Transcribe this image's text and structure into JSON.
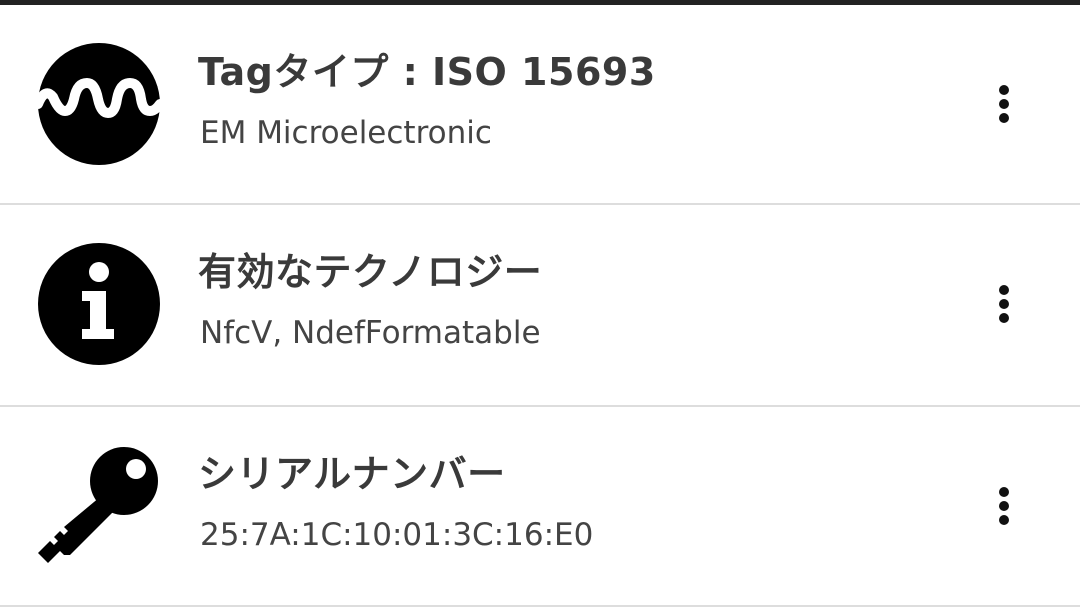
{
  "rows": [
    {
      "icon": "wave-icon",
      "title": "Tagタイプ : ISO 15693",
      "subtitle": "EM Microelectronic"
    },
    {
      "icon": "info-icon",
      "title": "有効なテクノロジー",
      "subtitle": "NfcV, NdefFormatable"
    },
    {
      "icon": "key-icon",
      "title": "シリアルナンバー",
      "subtitle": "25:7A:1C:10:01:3C:16:E0"
    }
  ],
  "more_icon": "more-vert-icon",
  "colors": {
    "top_bar": "#222222",
    "divider": "#dddddd",
    "title": "#3a3a3a",
    "subtitle": "#444444",
    "icon": "#000000"
  }
}
